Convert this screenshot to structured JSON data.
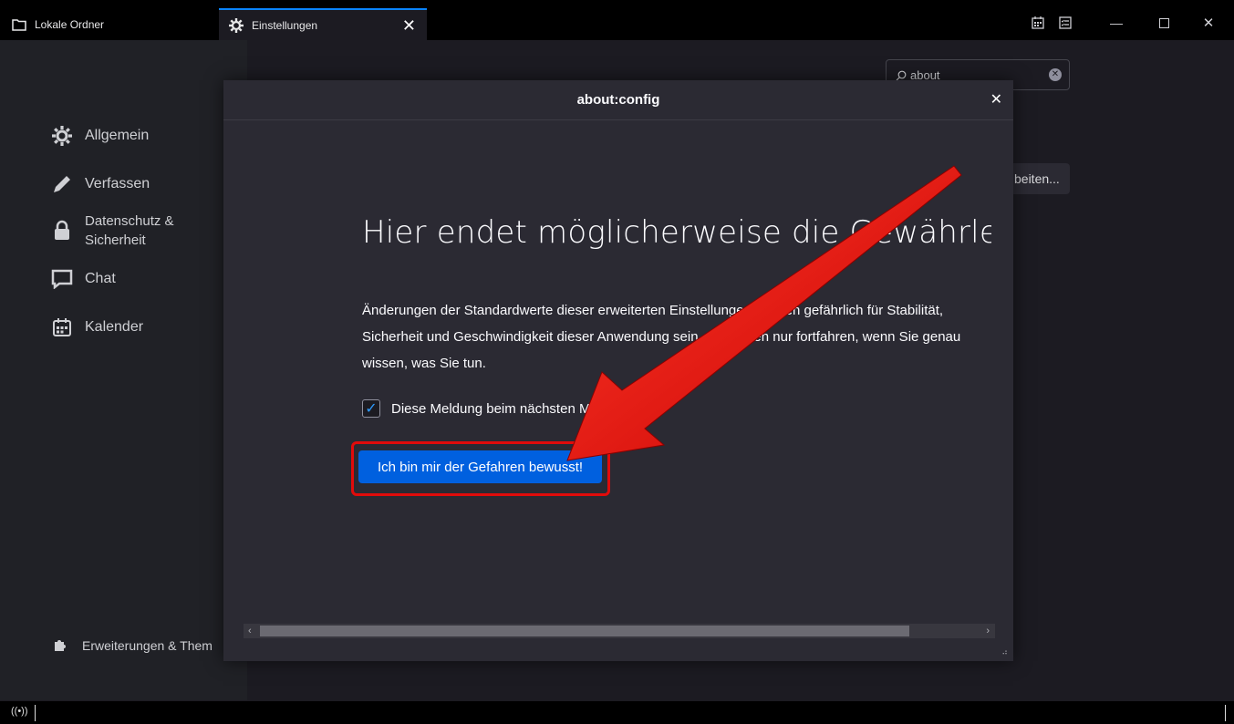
{
  "tabs": [
    {
      "label": "Lokale Ordner",
      "icon": "folder-icon"
    },
    {
      "label": "Einstellungen",
      "icon": "gear-icon",
      "active": true
    }
  ],
  "sidebar": {
    "items": [
      {
        "label": "Allgemein",
        "icon": "gear-icon"
      },
      {
        "label": "Verfassen",
        "icon": "pencil-icon"
      },
      {
        "label_line1": "Datenschutz &",
        "label_line2": "Sicherheit",
        "icon": "lock-icon"
      },
      {
        "label": "Chat",
        "icon": "chat-icon"
      },
      {
        "label": "Kalender",
        "icon": "calendar-icon"
      }
    ],
    "extensions": {
      "label": "Erweiterungen & Them",
      "icon": "puzzle-icon"
    }
  },
  "search": {
    "value": "about"
  },
  "background_button": {
    "label": "beiten..."
  },
  "dialog": {
    "header": "about:config",
    "title": "Hier endet möglicherweise die Gewährleistung",
    "text_lines": [
      "Änderungen der Standardwerte dieser erweiterten Einstellungen können gefährlich für Stabilität,",
      "Sicherheit und Geschwindigkeit dieser Anwendung sein. Sie sollten nur fortfahren, wenn Sie genau",
      "wissen, was Sie tun."
    ],
    "checkbox_label": "Diese Meldung beim nächsten Mal anzeigen",
    "checkbox_checked": true,
    "accept_button": "Ich bin mir der Gefahren bewusst!"
  },
  "colors": {
    "accent": "#0060df",
    "highlight_red": "#e10b0b",
    "tab_accent": "#0a84ff"
  }
}
